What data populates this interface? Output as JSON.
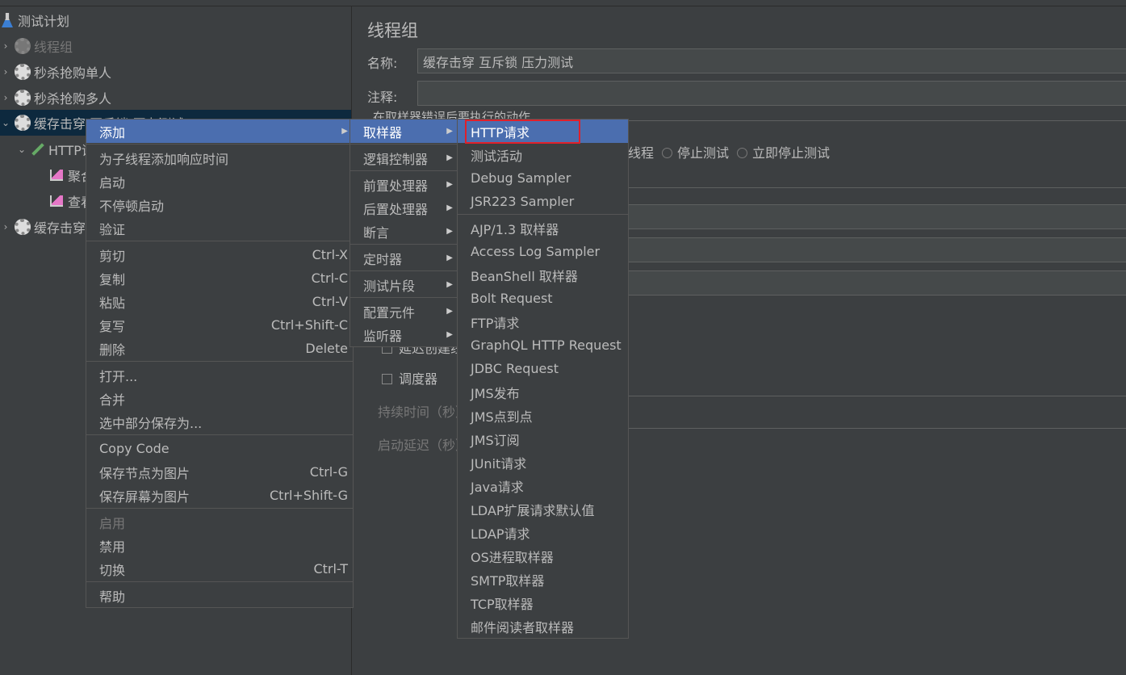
{
  "tree": [
    {
      "label": "测试计划",
      "icon": "flask-icon"
    },
    {
      "label": "线程组",
      "icon": "gear-icon",
      "disabled": true
    },
    {
      "label": "秒杀抢购单人",
      "icon": "gear-icon"
    },
    {
      "label": "秒杀抢购多人",
      "icon": "gear-icon"
    },
    {
      "label": "缓存击穿 互斥锁 压力测试",
      "icon": "gear-icon"
    },
    {
      "label": "HTTP请求",
      "icon": "pipette-icon"
    },
    {
      "label": "聚合报告",
      "icon": "chart-icon"
    },
    {
      "label": "查看结果树",
      "icon": "chart-icon"
    },
    {
      "label": "缓存击穿",
      "icon": "gear-icon"
    }
  ],
  "panel": {
    "title": "线程组",
    "name_label": "名称:",
    "name_value": "缓存击穿 互斥锁 压力测试",
    "comment_label": "注释:",
    "comment_value": "",
    "error_action_label": "在取样器错误后要执行的动作",
    "radio_partial": "线程",
    "radio_stop_test": "停止测试",
    "radio_stop_now": "立即停止测试",
    "delay_create": "延迟创建线程",
    "scheduler": "调度器",
    "duration_label": "持续时间（秒）",
    "startup_delay_label": "启动延迟（秒）"
  },
  "menu1": [
    {
      "label": "添加",
      "submenu": true
    },
    {
      "sep": true
    },
    {
      "label": "为子线程添加响应时间"
    },
    {
      "label": "启动"
    },
    {
      "label": "不停顿启动"
    },
    {
      "label": "验证"
    },
    {
      "sep": true
    },
    {
      "label": "剪切",
      "shortcut": "Ctrl-X"
    },
    {
      "label": "复制",
      "shortcut": "Ctrl-C"
    },
    {
      "label": "粘贴",
      "shortcut": "Ctrl-V"
    },
    {
      "label": "复写",
      "shortcut": "Ctrl+Shift-C"
    },
    {
      "label": "删除",
      "shortcut": "Delete"
    },
    {
      "sep": true
    },
    {
      "label": "打开..."
    },
    {
      "label": "合并"
    },
    {
      "label": "选中部分保存为..."
    },
    {
      "sep": true
    },
    {
      "label": "Copy Code"
    },
    {
      "label": "保存节点为图片",
      "shortcut": "Ctrl-G"
    },
    {
      "label": "保存屏幕为图片",
      "shortcut": "Ctrl+Shift-G"
    },
    {
      "sep": true
    },
    {
      "label": "启用",
      "disabled": true
    },
    {
      "label": "禁用"
    },
    {
      "label": "切换",
      "shortcut": "Ctrl-T"
    },
    {
      "sep": true
    },
    {
      "label": "帮助"
    }
  ],
  "menu2": [
    {
      "label": "取样器"
    },
    {
      "sep": true
    },
    {
      "label": "逻辑控制器"
    },
    {
      "sep": true
    },
    {
      "label": "前置处理器"
    },
    {
      "label": "后置处理器"
    },
    {
      "label": "断言"
    },
    {
      "sep": true
    },
    {
      "label": "定时器"
    },
    {
      "sep": true
    },
    {
      "label": "测试片段"
    },
    {
      "sep": true
    },
    {
      "label": "配置元件"
    },
    {
      "label": "监听器"
    }
  ],
  "menu3": [
    {
      "label": "HTTP请求"
    },
    {
      "label": "测试活动"
    },
    {
      "label": "Debug Sampler"
    },
    {
      "label": "JSR223 Sampler"
    },
    {
      "sep": true
    },
    {
      "label": "AJP/1.3 取样器"
    },
    {
      "label": "Access Log Sampler"
    },
    {
      "label": "BeanShell 取样器"
    },
    {
      "label": "Bolt Request"
    },
    {
      "label": "FTP请求"
    },
    {
      "label": "GraphQL HTTP Request"
    },
    {
      "label": "JDBC Request"
    },
    {
      "label": "JMS发布"
    },
    {
      "label": "JMS点到点"
    },
    {
      "label": "JMS订阅"
    },
    {
      "label": "JUnit请求"
    },
    {
      "label": "Java请求"
    },
    {
      "label": "LDAP扩展请求默认值"
    },
    {
      "label": "LDAP请求"
    },
    {
      "label": "OS进程取样器"
    },
    {
      "label": "SMTP取样器"
    },
    {
      "label": "TCP取样器"
    },
    {
      "label": "邮件阅读者取样器"
    }
  ],
  "colors": {
    "highlight": "#4b6eaf",
    "selection": "#0d293e",
    "focus_box": "#e0202a"
  }
}
